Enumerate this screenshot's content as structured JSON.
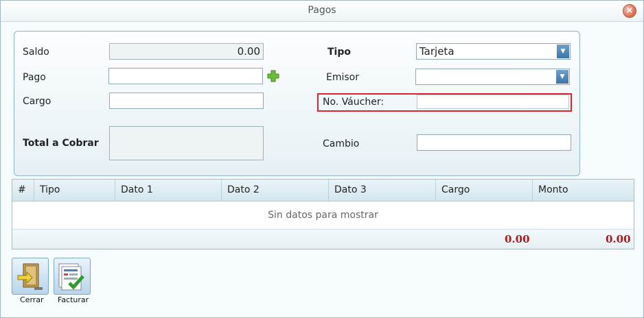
{
  "window": {
    "title": "Pagos"
  },
  "form": {
    "saldo_label": "Saldo",
    "saldo_value": "0.00",
    "pago_label": "Pago",
    "pago_value": "",
    "cargo_label": "Cargo",
    "cargo_value": "",
    "total_label": "Total a Cobrar",
    "total_value": "",
    "tipo_label": "Tipo",
    "tipo_value": "Tarjeta",
    "emisor_label": "Emisor",
    "emisor_value": "",
    "voucher_label": "No. Váucher:",
    "voucher_value": "",
    "cambio_label": "Cambio",
    "cambio_value": ""
  },
  "grid": {
    "columns": [
      "#",
      "Tipo",
      "Dato 1",
      "Dato 2",
      "Dato 3",
      "Cargo",
      "Monto"
    ],
    "empty_text": "Sin datos para mostrar",
    "totals": {
      "cargo": "0.00",
      "monto": "0.00"
    }
  },
  "toolbar": {
    "cerrar_label": "Cerrar",
    "facturar_label": "Facturar"
  },
  "colors": {
    "highlight": "#d9232f",
    "totals": "#a61b1b"
  },
  "icons": {
    "close": "close-icon",
    "add": "plus-icon",
    "exit": "exit-door-icon",
    "invoice": "invoice-check-icon"
  }
}
